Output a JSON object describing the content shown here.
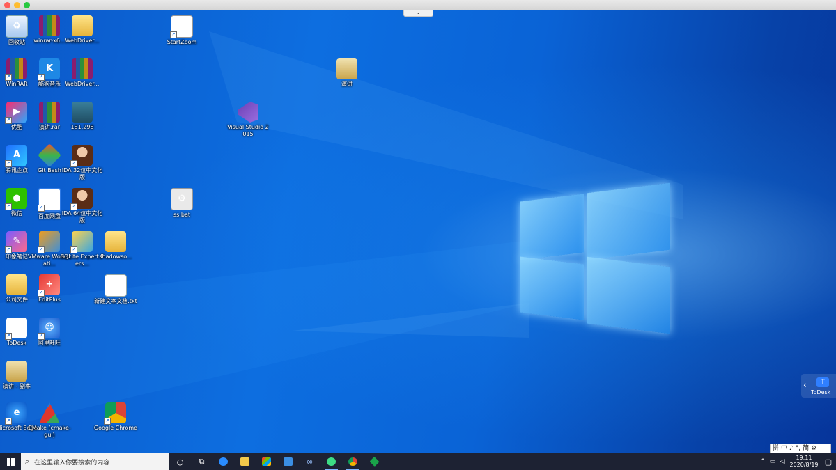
{
  "desktop_icons": [
    {
      "label": "回收站",
      "icon": "recycle-bin-icon"
    },
    {
      "label": "winrar-x6...",
      "icon": "winrar-archive-icon"
    },
    {
      "label": "WebDriver...",
      "icon": "folder-icon"
    },
    {
      "label": "WinRAR",
      "icon": "winrar-icon"
    },
    {
      "label": "酷狗音乐",
      "icon": "kugou-music-icon"
    },
    {
      "label": "WebDriver...",
      "icon": "winrar-archive-icon"
    },
    {
      "label": "优酷",
      "icon": "youku-icon"
    },
    {
      "label": "演讲.rar",
      "icon": "winrar-archive-icon"
    },
    {
      "label": "181.298",
      "icon": "executable-icon"
    },
    {
      "label": "腾讯企点",
      "icon": "tencent-qidian-icon"
    },
    {
      "label": "Git Bash",
      "icon": "git-bash-icon"
    },
    {
      "label": "IDA 32位中文化版",
      "icon": "ida-icon"
    },
    {
      "label": "微信",
      "icon": "wechat-icon"
    },
    {
      "label": "百度网盘",
      "icon": "baidu-netdisk-icon"
    },
    {
      "label": "IDA 64位中文化版",
      "icon": "ida-icon"
    },
    {
      "label": "印象笔记",
      "icon": "evernote-icon"
    },
    {
      "label": "VMware Workstati...",
      "icon": "vmware-icon"
    },
    {
      "label": "SQLite Expert Pers...",
      "icon": "sqlite-expert-icon"
    },
    {
      "label": "shadowso...",
      "icon": "folder-icon"
    },
    {
      "label": "公司文件",
      "icon": "folder-icon"
    },
    {
      "label": "EditPlus",
      "icon": "editplus-icon"
    },
    {
      "label": "新建文本文档.txt",
      "icon": "text-file-icon"
    },
    {
      "label": "ToDesk",
      "icon": "todesk-icon"
    },
    {
      "label": "阿里旺旺",
      "icon": "aliwangwang-icon"
    },
    {
      "label": "演讲 - 副本",
      "icon": "document-folder-icon"
    },
    {
      "label": "Microsoft Edge",
      "icon": "edge-icon"
    },
    {
      "label": "CMake (cmake-gui)",
      "icon": "cmake-icon"
    },
    {
      "label": "Google Chrome",
      "icon": "chrome-icon"
    },
    {
      "label": "StartZoom",
      "icon": "zoom-shortcut-icon"
    },
    {
      "label": "演讲",
      "icon": "document-folder-icon"
    },
    {
      "label": "Visual Studio 2015",
      "icon": "visual-studio-icon"
    },
    {
      "label": "ss.bat",
      "icon": "batch-file-icon"
    }
  ],
  "todesk_tab": {
    "label": "ToDesk"
  },
  "ime_bar": {
    "items": [
      "拼",
      "中",
      "♪",
      "°,",
      "简",
      "⚙"
    ]
  },
  "taskbar": {
    "search_placeholder": "在这里输入你要搜索的内容",
    "pinned": [
      "cortana-icon",
      "task-view-icon",
      "edge-icon",
      "file-explorer-icon",
      "store-icon",
      "mail-icon",
      "infinity-app-icon",
      "android-studio-icon",
      "chrome-icon",
      "green-app-icon"
    ],
    "clock_time": "19:11",
    "clock_date": "2020/8/19"
  }
}
